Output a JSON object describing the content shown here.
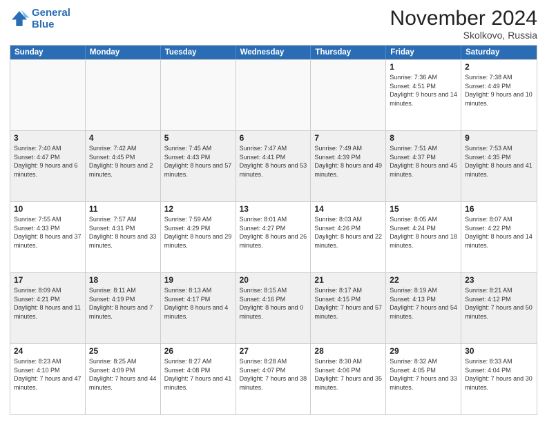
{
  "logo": {
    "line1": "General",
    "line2": "Blue"
  },
  "title": "November 2024",
  "subtitle": "Skolkovo, Russia",
  "days": [
    "Sunday",
    "Monday",
    "Tuesday",
    "Wednesday",
    "Thursday",
    "Friday",
    "Saturday"
  ],
  "weeks": [
    [
      {
        "day": "",
        "info": ""
      },
      {
        "day": "",
        "info": ""
      },
      {
        "day": "",
        "info": ""
      },
      {
        "day": "",
        "info": ""
      },
      {
        "day": "",
        "info": ""
      },
      {
        "day": "1",
        "info": "Sunrise: 7:36 AM\nSunset: 4:51 PM\nDaylight: 9 hours and 14 minutes."
      },
      {
        "day": "2",
        "info": "Sunrise: 7:38 AM\nSunset: 4:49 PM\nDaylight: 9 hours and 10 minutes."
      }
    ],
    [
      {
        "day": "3",
        "info": "Sunrise: 7:40 AM\nSunset: 4:47 PM\nDaylight: 9 hours and 6 minutes."
      },
      {
        "day": "4",
        "info": "Sunrise: 7:42 AM\nSunset: 4:45 PM\nDaylight: 9 hours and 2 minutes."
      },
      {
        "day": "5",
        "info": "Sunrise: 7:45 AM\nSunset: 4:43 PM\nDaylight: 8 hours and 57 minutes."
      },
      {
        "day": "6",
        "info": "Sunrise: 7:47 AM\nSunset: 4:41 PM\nDaylight: 8 hours and 53 minutes."
      },
      {
        "day": "7",
        "info": "Sunrise: 7:49 AM\nSunset: 4:39 PM\nDaylight: 8 hours and 49 minutes."
      },
      {
        "day": "8",
        "info": "Sunrise: 7:51 AM\nSunset: 4:37 PM\nDaylight: 8 hours and 45 minutes."
      },
      {
        "day": "9",
        "info": "Sunrise: 7:53 AM\nSunset: 4:35 PM\nDaylight: 8 hours and 41 minutes."
      }
    ],
    [
      {
        "day": "10",
        "info": "Sunrise: 7:55 AM\nSunset: 4:33 PM\nDaylight: 8 hours and 37 minutes."
      },
      {
        "day": "11",
        "info": "Sunrise: 7:57 AM\nSunset: 4:31 PM\nDaylight: 8 hours and 33 minutes."
      },
      {
        "day": "12",
        "info": "Sunrise: 7:59 AM\nSunset: 4:29 PM\nDaylight: 8 hours and 29 minutes."
      },
      {
        "day": "13",
        "info": "Sunrise: 8:01 AM\nSunset: 4:27 PM\nDaylight: 8 hours and 26 minutes."
      },
      {
        "day": "14",
        "info": "Sunrise: 8:03 AM\nSunset: 4:26 PM\nDaylight: 8 hours and 22 minutes."
      },
      {
        "day": "15",
        "info": "Sunrise: 8:05 AM\nSunset: 4:24 PM\nDaylight: 8 hours and 18 minutes."
      },
      {
        "day": "16",
        "info": "Sunrise: 8:07 AM\nSunset: 4:22 PM\nDaylight: 8 hours and 14 minutes."
      }
    ],
    [
      {
        "day": "17",
        "info": "Sunrise: 8:09 AM\nSunset: 4:21 PM\nDaylight: 8 hours and 11 minutes."
      },
      {
        "day": "18",
        "info": "Sunrise: 8:11 AM\nSunset: 4:19 PM\nDaylight: 8 hours and 7 minutes."
      },
      {
        "day": "19",
        "info": "Sunrise: 8:13 AM\nSunset: 4:17 PM\nDaylight: 8 hours and 4 minutes."
      },
      {
        "day": "20",
        "info": "Sunrise: 8:15 AM\nSunset: 4:16 PM\nDaylight: 8 hours and 0 minutes."
      },
      {
        "day": "21",
        "info": "Sunrise: 8:17 AM\nSunset: 4:15 PM\nDaylight: 7 hours and 57 minutes."
      },
      {
        "day": "22",
        "info": "Sunrise: 8:19 AM\nSunset: 4:13 PM\nDaylight: 7 hours and 54 minutes."
      },
      {
        "day": "23",
        "info": "Sunrise: 8:21 AM\nSunset: 4:12 PM\nDaylight: 7 hours and 50 minutes."
      }
    ],
    [
      {
        "day": "24",
        "info": "Sunrise: 8:23 AM\nSunset: 4:10 PM\nDaylight: 7 hours and 47 minutes."
      },
      {
        "day": "25",
        "info": "Sunrise: 8:25 AM\nSunset: 4:09 PM\nDaylight: 7 hours and 44 minutes."
      },
      {
        "day": "26",
        "info": "Sunrise: 8:27 AM\nSunset: 4:08 PM\nDaylight: 7 hours and 41 minutes."
      },
      {
        "day": "27",
        "info": "Sunrise: 8:28 AM\nSunset: 4:07 PM\nDaylight: 7 hours and 38 minutes."
      },
      {
        "day": "28",
        "info": "Sunrise: 8:30 AM\nSunset: 4:06 PM\nDaylight: 7 hours and 35 minutes."
      },
      {
        "day": "29",
        "info": "Sunrise: 8:32 AM\nSunset: 4:05 PM\nDaylight: 7 hours and 33 minutes."
      },
      {
        "day": "30",
        "info": "Sunrise: 8:33 AM\nSunset: 4:04 PM\nDaylight: 7 hours and 30 minutes."
      }
    ]
  ]
}
